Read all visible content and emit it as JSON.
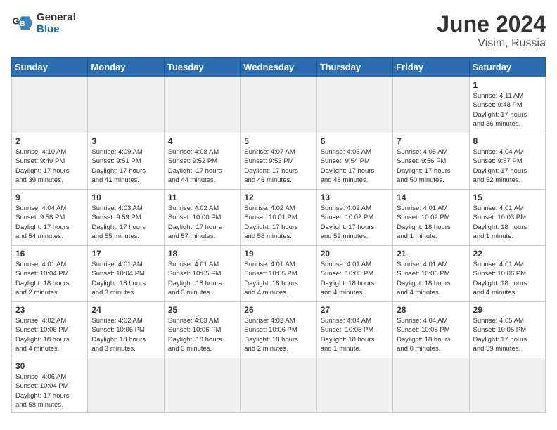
{
  "header": {
    "logo_general": "General",
    "logo_blue": "Blue",
    "month": "June 2024",
    "location": "Visim, Russia"
  },
  "days_of_week": [
    "Sunday",
    "Monday",
    "Tuesday",
    "Wednesday",
    "Thursday",
    "Friday",
    "Saturday"
  ],
  "weeks": [
    [
      {
        "day": null,
        "info": null
      },
      {
        "day": null,
        "info": null
      },
      {
        "day": null,
        "info": null
      },
      {
        "day": null,
        "info": null
      },
      {
        "day": null,
        "info": null
      },
      {
        "day": null,
        "info": null
      },
      {
        "day": "1",
        "info": "Sunrise: 4:11 AM\nSunset: 9:48 PM\nDaylight: 17 hours\nand 36 minutes."
      }
    ],
    [
      {
        "day": "2",
        "info": "Sunrise: 4:10 AM\nSunset: 9:49 PM\nDaylight: 17 hours\nand 39 minutes."
      },
      {
        "day": "3",
        "info": "Sunrise: 4:09 AM\nSunset: 9:51 PM\nDaylight: 17 hours\nand 41 minutes."
      },
      {
        "day": "4",
        "info": "Sunrise: 4:08 AM\nSunset: 9:52 PM\nDaylight: 17 hours\nand 44 minutes."
      },
      {
        "day": "5",
        "info": "Sunrise: 4:07 AM\nSunset: 9:53 PM\nDaylight: 17 hours\nand 46 minutes."
      },
      {
        "day": "6",
        "info": "Sunrise: 4:06 AM\nSunset: 9:54 PM\nDaylight: 17 hours\nand 48 minutes."
      },
      {
        "day": "7",
        "info": "Sunrise: 4:05 AM\nSunset: 9:56 PM\nDaylight: 17 hours\nand 50 minutes."
      },
      {
        "day": "8",
        "info": "Sunrise: 4:04 AM\nSunset: 9:57 PM\nDaylight: 17 hours\nand 52 minutes."
      }
    ],
    [
      {
        "day": "9",
        "info": "Sunrise: 4:04 AM\nSunset: 9:58 PM\nDaylight: 17 hours\nand 54 minutes."
      },
      {
        "day": "10",
        "info": "Sunrise: 4:03 AM\nSunset: 9:59 PM\nDaylight: 17 hours\nand 55 minutes."
      },
      {
        "day": "11",
        "info": "Sunrise: 4:02 AM\nSunset: 10:00 PM\nDaylight: 17 hours\nand 57 minutes."
      },
      {
        "day": "12",
        "info": "Sunrise: 4:02 AM\nSunset: 10:01 PM\nDaylight: 17 hours\nand 58 minutes."
      },
      {
        "day": "13",
        "info": "Sunrise: 4:02 AM\nSunset: 10:02 PM\nDaylight: 17 hours\nand 59 minutes."
      },
      {
        "day": "14",
        "info": "Sunrise: 4:01 AM\nSunset: 10:02 PM\nDaylight: 18 hours\nand 1 minute."
      },
      {
        "day": "15",
        "info": "Sunrise: 4:01 AM\nSunset: 10:03 PM\nDaylight: 18 hours\nand 1 minute."
      }
    ],
    [
      {
        "day": "16",
        "info": "Sunrise: 4:01 AM\nSunset: 10:04 PM\nDaylight: 18 hours\nand 2 minutes."
      },
      {
        "day": "17",
        "info": "Sunrise: 4:01 AM\nSunset: 10:04 PM\nDaylight: 18 hours\nand 3 minutes."
      },
      {
        "day": "18",
        "info": "Sunrise: 4:01 AM\nSunset: 10:05 PM\nDaylight: 18 hours\nand 3 minutes."
      },
      {
        "day": "19",
        "info": "Sunrise: 4:01 AM\nSunset: 10:05 PM\nDaylight: 18 hours\nand 4 minutes."
      },
      {
        "day": "20",
        "info": "Sunrise: 4:01 AM\nSunset: 10:05 PM\nDaylight: 18 hours\nand 4 minutes."
      },
      {
        "day": "21",
        "info": "Sunrise: 4:01 AM\nSunset: 10:06 PM\nDaylight: 18 hours\nand 4 minutes."
      },
      {
        "day": "22",
        "info": "Sunrise: 4:01 AM\nSunset: 10:06 PM\nDaylight: 18 hours\nand 4 minutes."
      }
    ],
    [
      {
        "day": "23",
        "info": "Sunrise: 4:02 AM\nSunset: 10:06 PM\nDaylight: 18 hours\nand 4 minutes."
      },
      {
        "day": "24",
        "info": "Sunrise: 4:02 AM\nSunset: 10:06 PM\nDaylight: 18 hours\nand 3 minutes."
      },
      {
        "day": "25",
        "info": "Sunrise: 4:03 AM\nSunset: 10:06 PM\nDaylight: 18 hours\nand 3 minutes."
      },
      {
        "day": "26",
        "info": "Sunrise: 4:03 AM\nSunset: 10:06 PM\nDaylight: 18 hours\nand 2 minutes."
      },
      {
        "day": "27",
        "info": "Sunrise: 4:04 AM\nSunset: 10:05 PM\nDaylight: 18 hours\nand 1 minute."
      },
      {
        "day": "28",
        "info": "Sunrise: 4:04 AM\nSunset: 10:05 PM\nDaylight: 18 hours\nand 0 minutes."
      },
      {
        "day": "29",
        "info": "Sunrise: 4:05 AM\nSunset: 10:05 PM\nDaylight: 17 hours\nand 59 minutes."
      }
    ],
    [
      {
        "day": "30",
        "info": "Sunrise: 4:06 AM\nSunset: 10:04 PM\nDaylight: 17 hours\nand 58 minutes."
      },
      {
        "day": null,
        "info": null
      },
      {
        "day": null,
        "info": null
      },
      {
        "day": null,
        "info": null
      },
      {
        "day": null,
        "info": null
      },
      {
        "day": null,
        "info": null
      },
      {
        "day": null,
        "info": null
      }
    ]
  ]
}
